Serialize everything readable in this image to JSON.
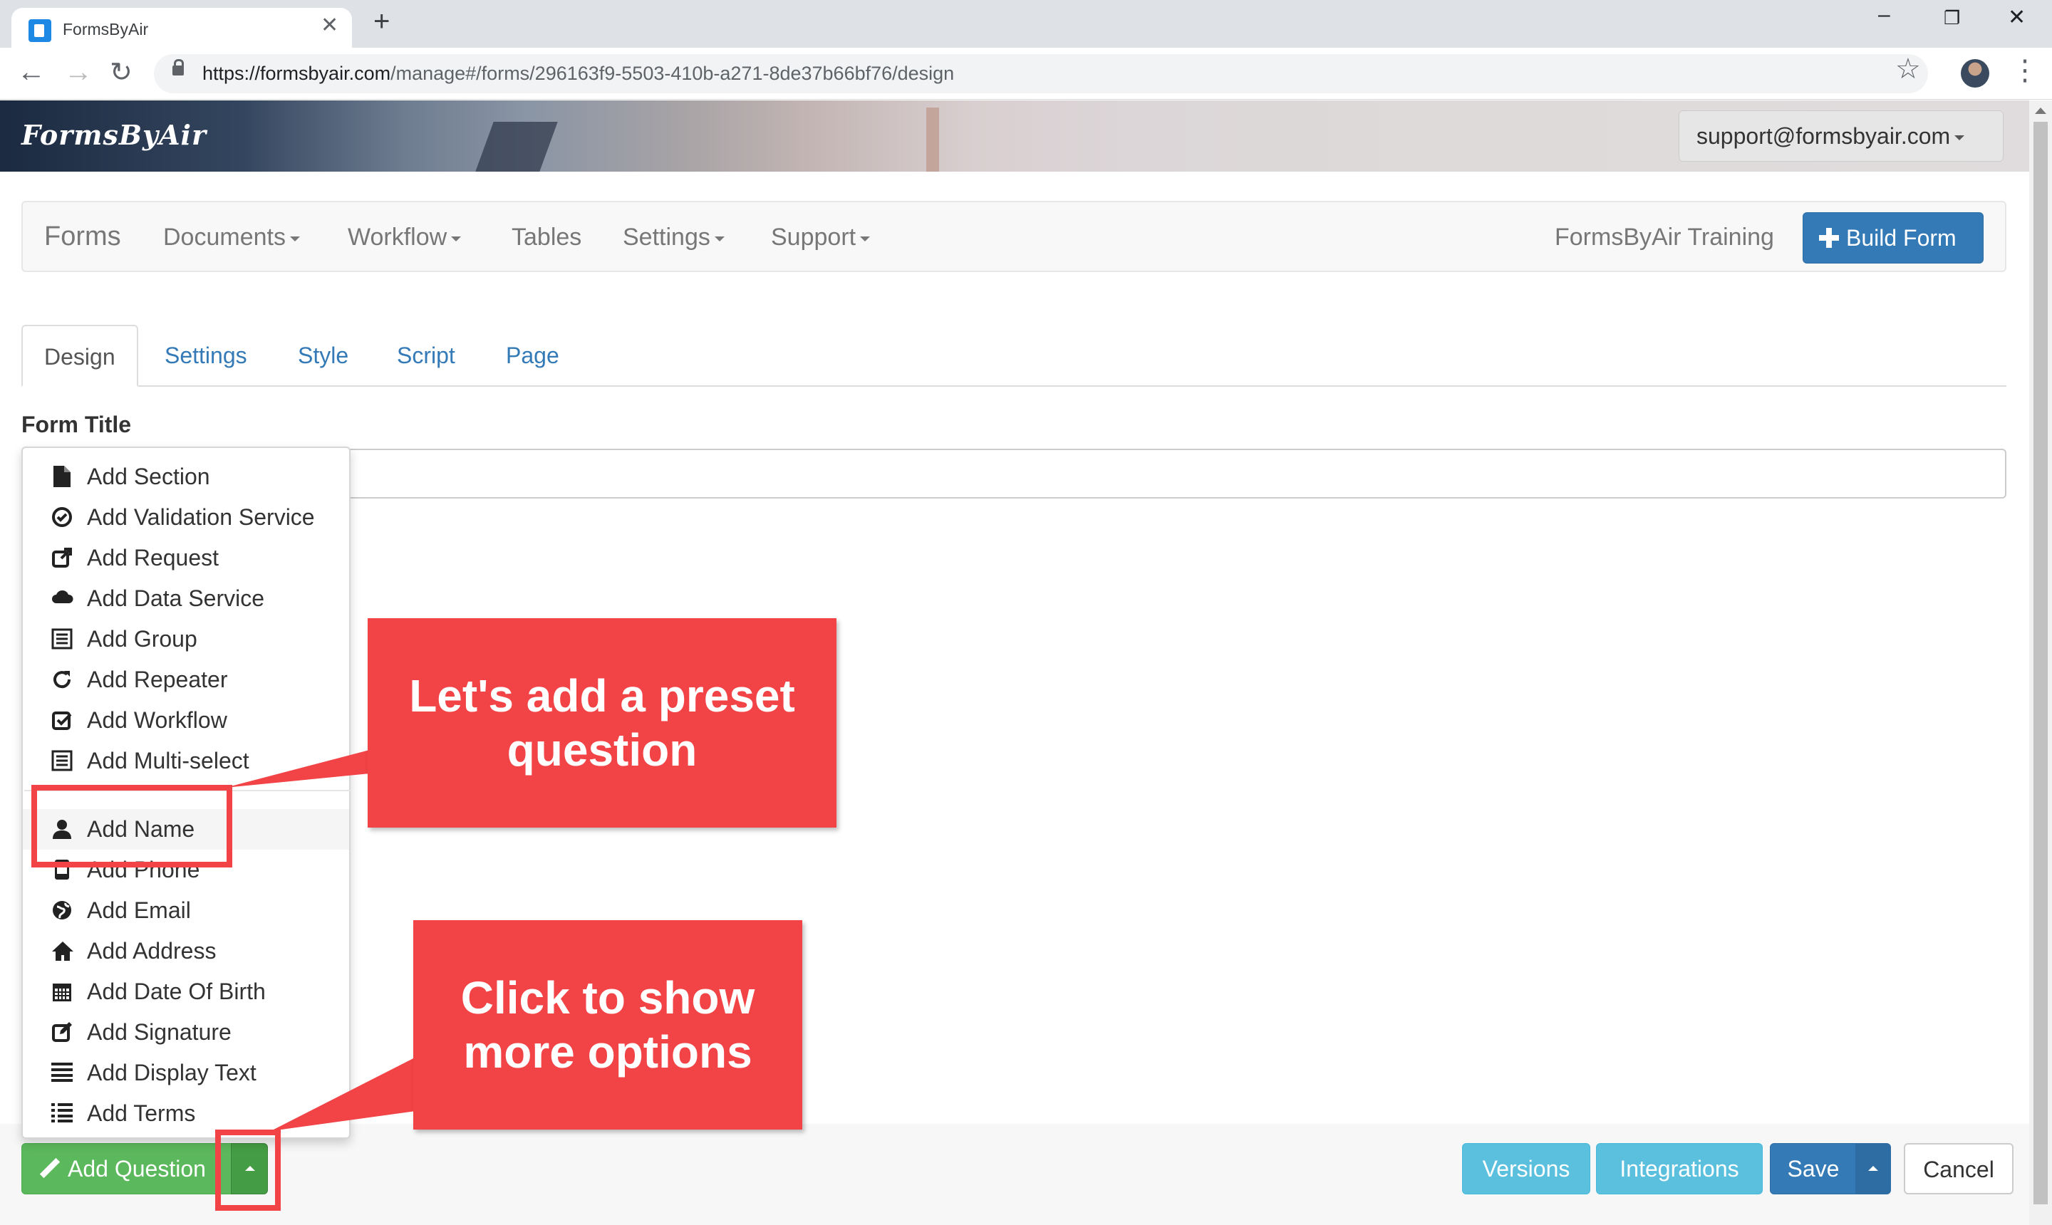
{
  "browser": {
    "tab_title": "FormsByAir",
    "url_host": "https://formsbyair.com",
    "url_path": "/manage#/forms/296163f9-5503-410b-a271-8de37b66bf76/design"
  },
  "banner": {
    "brand": "FormsByAir",
    "user_email": "support@formsbyair.com"
  },
  "navbar": {
    "items": [
      "Forms",
      "Documents",
      "Workflow",
      "Tables",
      "Settings",
      "Support"
    ],
    "org": "FormsByAir Training",
    "build_form": "Build Form"
  },
  "page_tabs": [
    "Design",
    "Settings",
    "Style",
    "Script",
    "Page"
  ],
  "form_title_label": "Form Title",
  "menu": {
    "structural": [
      {
        "icon": "file-icon",
        "label": "Add Section"
      },
      {
        "icon": "check-circle-icon",
        "label": "Add Validation Service"
      },
      {
        "icon": "share-icon",
        "label": "Add Request"
      },
      {
        "icon": "cloud-icon",
        "label": "Add Data Service"
      },
      {
        "icon": "list-alt-icon",
        "label": "Add Group"
      },
      {
        "icon": "refresh-icon",
        "label": "Add Repeater"
      },
      {
        "icon": "check-square-icon",
        "label": "Add Workflow"
      },
      {
        "icon": "list-alt-icon",
        "label": "Add Multi-select"
      }
    ],
    "preset": [
      {
        "icon": "user-icon",
        "label": "Add Name"
      },
      {
        "icon": "phone-icon",
        "label": "Add Phone"
      },
      {
        "icon": "globe-icon",
        "label": "Add Email"
      },
      {
        "icon": "home-icon",
        "label": "Add Address"
      },
      {
        "icon": "calendar-icon",
        "label": "Add Date Of Birth"
      },
      {
        "icon": "edit-icon",
        "label": "Add Signature"
      },
      {
        "icon": "align-justify-icon",
        "label": "Add Display Text"
      },
      {
        "icon": "list-icon",
        "label": "Add Terms"
      }
    ]
  },
  "footer": {
    "add_question": "Add Question",
    "versions": "Versions",
    "integrations": "Integrations",
    "save": "Save",
    "cancel": "Cancel"
  },
  "callouts": {
    "preset": "Let's add a preset question",
    "more_options": "Click to show more options"
  },
  "colors": {
    "callout": "#f24346",
    "primary": "#337ab7",
    "success": "#5cb85c",
    "info": "#5bc0de"
  }
}
